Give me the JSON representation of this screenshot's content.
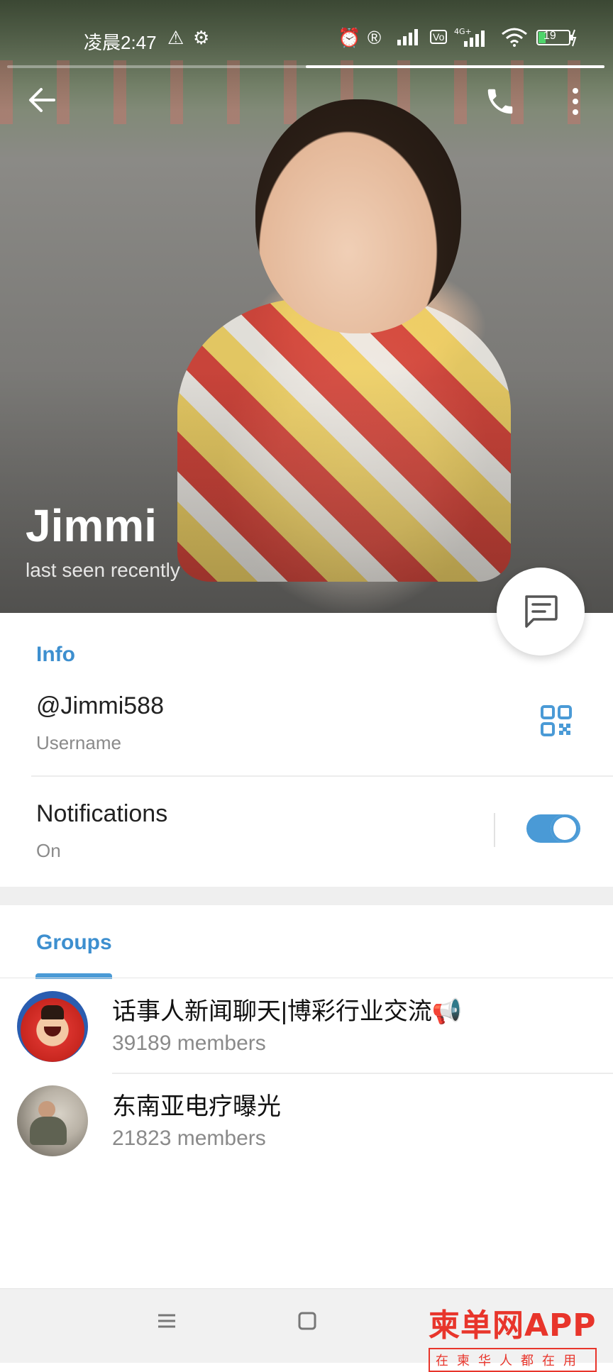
{
  "status_bar": {
    "time": "凌晨2:47",
    "battery": "19"
  },
  "media_progress": {
    "fraction": 0.5
  },
  "profile": {
    "name": "Jimmi",
    "status": "last seen recently"
  },
  "info": {
    "title": "Info",
    "username": "@Jimmi588",
    "username_label": "Username",
    "notifications_label": "Notifications",
    "notifications_value": "On"
  },
  "groups": {
    "title": "Groups",
    "items": [
      {
        "name": "话事人新闻聊天|博彩行业交流📢",
        "members": "39189 members"
      },
      {
        "name": "东南亚电疗曝光",
        "members": "21823 members"
      }
    ]
  },
  "watermark": {
    "brand": "柬单网APP",
    "sub": "在柬华人都在用"
  },
  "colors": {
    "accent": "#3d8fcf",
    "toggle_on": "#4a9ad6",
    "watermark": "#e8352b"
  },
  "icons": [
    "back-arrow-icon",
    "phone-icon",
    "more-vertical-icon",
    "message-icon",
    "qr-code-icon",
    "menu-icon",
    "home-square-icon"
  ]
}
